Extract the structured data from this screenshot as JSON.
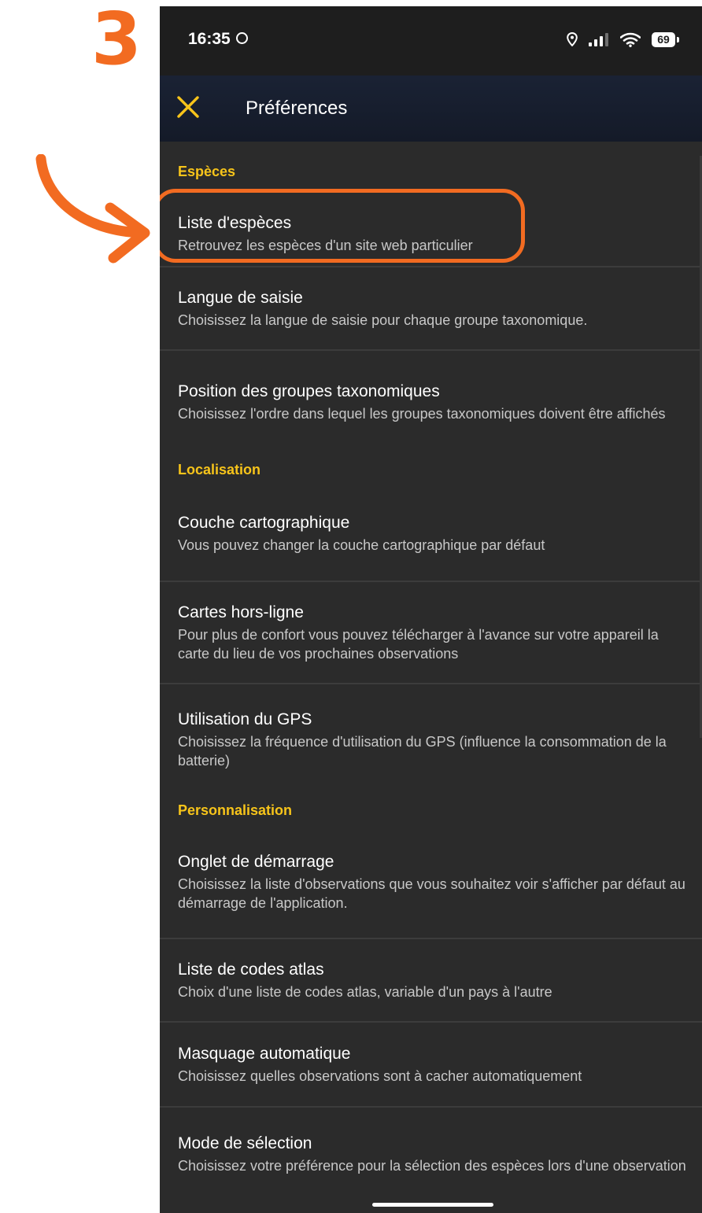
{
  "annotation": {
    "step_number": "3",
    "accent_color": "#f26b21"
  },
  "status_bar": {
    "time": "16:35",
    "battery": "69",
    "icons": [
      "location-pin-icon",
      "signal-bars-icon",
      "wifi-icon",
      "battery-icon"
    ]
  },
  "app_bar": {
    "title": "Préférences",
    "close_icon": "close-icon",
    "accent_color": "#f7c41a"
  },
  "sections": [
    {
      "header": "Espèces",
      "items": [
        {
          "title": "Liste d'espèces",
          "subtitle": "Retrouvez les espèces d'un site web particulier",
          "highlighted": true
        },
        {
          "title": "Langue de saisie",
          "subtitle": "Choisissez la langue de saisie pour chaque groupe taxonomique."
        },
        {
          "title": "Position des groupes taxonomiques",
          "subtitle": "Choisissez l'ordre dans lequel les groupes taxonomiques doivent être affichés"
        }
      ]
    },
    {
      "header": "Localisation",
      "items": [
        {
          "title": "Couche cartographique",
          "subtitle": "Vous pouvez changer la couche cartographique par défaut"
        },
        {
          "title": "Cartes hors-ligne",
          "subtitle": "Pour plus de confort vous pouvez télécharger à l'avance sur votre appareil la carte du lieu de vos prochaines observations"
        },
        {
          "title": "Utilisation du GPS",
          "subtitle": "Choisissez la fréquence d'utilisation du GPS (influence la consommation de la batterie)"
        }
      ]
    },
    {
      "header": "Personnalisation",
      "items": [
        {
          "title": "Onglet de démarrage",
          "subtitle": "Choisissez la liste d'observations que vous souhaitez voir s'afficher par défaut au démarrage de l'application."
        },
        {
          "title": "Liste de codes atlas",
          "subtitle": "Choix d'une liste de codes atlas, variable d'un pays à l'autre"
        },
        {
          "title": "Masquage automatique",
          "subtitle": "Choisissez quelles observations sont à cacher automatiquement"
        },
        {
          "title": "Mode de sélection",
          "subtitle": "Choisissez votre préférence pour la sélection des espèces lors d'une observation"
        }
      ]
    }
  ]
}
